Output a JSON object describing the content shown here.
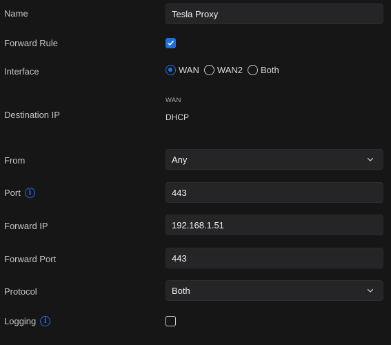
{
  "fields": {
    "name": {
      "label": "Name",
      "value": "Tesla Proxy"
    },
    "forward_rule": {
      "label": "Forward Rule",
      "checked": true
    },
    "interface": {
      "label": "Interface",
      "options": [
        "WAN",
        "WAN2",
        "Both"
      ],
      "selected": "WAN"
    },
    "destination_ip": {
      "label": "Destination IP",
      "caption": "WAN",
      "value": "DHCP"
    },
    "from": {
      "label": "From",
      "value": "Any"
    },
    "port": {
      "label": "Port",
      "value": "443",
      "info_icon": "info-icon"
    },
    "forward_ip": {
      "label": "Forward IP",
      "value": "192.168.1.51"
    },
    "forward_port": {
      "label": "Forward Port",
      "value": "443"
    },
    "protocol": {
      "label": "Protocol",
      "value": "Both"
    },
    "logging": {
      "label": "Logging",
      "checked": false,
      "info_icon": "info-icon"
    }
  },
  "colors": {
    "background": "#161617",
    "field_background": "#252528",
    "accent": "#1e72e6"
  }
}
